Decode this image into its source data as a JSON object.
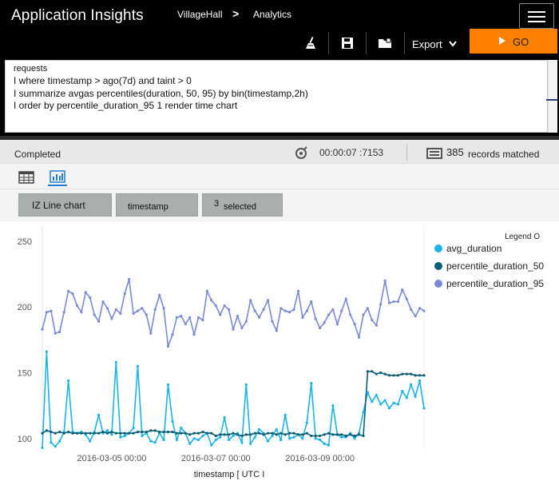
{
  "header": {
    "app_title": "Application Insights",
    "breadcrumb": [
      "VillageHall",
      "Analytics"
    ],
    "breadcrumb_separator": ">"
  },
  "toolbar": {
    "icons": [
      "broom-icon",
      "save-icon",
      "folder-icon"
    ],
    "export_label": "Export",
    "go_label": "GO",
    "go_color": "#ff7f00"
  },
  "query": {
    "lines": [
      "requests",
      "I where timestamp > ago(7d) and taint > 0",
      "I summarize avgas percentiles(duration, 50, 95) by bin(timestamp,2h)",
      "I order by percentile_duration_95 1 render time chart"
    ]
  },
  "status": {
    "state": "Completed",
    "elapsed": "00:00:07 :7153",
    "records_count": "385",
    "records_label": "records matched"
  },
  "options": {
    "chart_type": "IZ Line chart",
    "x_column": "timestamp",
    "selected_count": "3",
    "selected_label": "selected"
  },
  "chart_data": {
    "type": "line",
    "xlabel": "timestamp [ UTC I",
    "ylabel": "",
    "ylim": [
      92,
      262
    ],
    "yticks": [
      100,
      150,
      200,
      250
    ],
    "xtick_labels": [
      "2016-03-05 00:00",
      "2016-03-07 00:00",
      "2016-03-09 00:00"
    ],
    "xtick_index": [
      16,
      40,
      64
    ],
    "legend_title": "Legend O",
    "legend_position": "right",
    "series": [
      {
        "name": "avg_duration",
        "color": "#1ab4e6",
        "values": [
          93,
          166,
          97,
          94,
          98,
          105,
          144,
          105,
          104,
          105,
          103,
          98,
          105,
          118,
          104,
          106,
          103,
          158,
          101,
          102,
          104,
          108,
          155,
          102,
          104,
          98,
          97,
          104,
          99,
          141,
          113,
          99,
          108,
          104,
          96,
          100,
          99,
          102,
          104,
          95,
          99,
          101,
          116,
          99,
          102,
          104,
          97,
          141,
          96,
          101,
          107,
          104,
          98,
          102,
          107,
          99,
          118,
          100,
          101,
          103,
          100,
          112,
          142,
          100,
          99,
          96,
          95,
          125,
          103,
          101,
          101,
          104,
          100,
          104,
          120,
          135,
          128,
          133,
          126,
          129,
          123,
          127,
          126,
          136,
          131,
          141,
          132,
          144,
          123
        ]
      },
      {
        "name": "percentile_duration_50",
        "color": "#0a5f74",
        "values": [
          104,
          106,
          105,
          104,
          105,
          104,
          105,
          104,
          104,
          104,
          104,
          104,
          104,
          104,
          105,
          104,
          105,
          104,
          104,
          104,
          104,
          104,
          105,
          105,
          105,
          106,
          106,
          105,
          105,
          105,
          105,
          104,
          104,
          104,
          103,
          104,
          104,
          105,
          104,
          104,
          102,
          103,
          103,
          103,
          104,
          103,
          102,
          103,
          103,
          104,
          104,
          103,
          104,
          104,
          103,
          104,
          103,
          104,
          104,
          103,
          103,
          104,
          102,
          102,
          102,
          103,
          104,
          103,
          103,
          103,
          102,
          103,
          102,
          103,
          102,
          151,
          151,
          149,
          150,
          149,
          148,
          148,
          148,
          149,
          149,
          149,
          148,
          148,
          148
        ]
      },
      {
        "name": "percentile_duration_95",
        "color": "#7b8ad6",
        "values": [
          183,
          196,
          197,
          180,
          181,
          196,
          212,
          210,
          201,
          196,
          211,
          207,
          194,
          189,
          204,
          199,
          191,
          198,
          195,
          210,
          221,
          195,
          197,
          199,
          194,
          180,
          198,
          209,
          199,
          170,
          179,
          192,
          193,
          187,
          192,
          179,
          192,
          190,
          212,
          205,
          201,
          194,
          201,
          198,
          183,
          193,
          184,
          189,
          205,
          197,
          192,
          198,
          205,
          189,
          182,
          199,
          197,
          196,
          198,
          212,
          192,
          197,
          204,
          191,
          184,
          188,
          194,
          198,
          187,
          197,
          206,
          194,
          187,
          177,
          194,
          199,
          190,
          186,
          202,
          220,
          203,
          204,
          204,
          213,
          206,
          198,
          193,
          199,
          197
        ]
      }
    ]
  }
}
